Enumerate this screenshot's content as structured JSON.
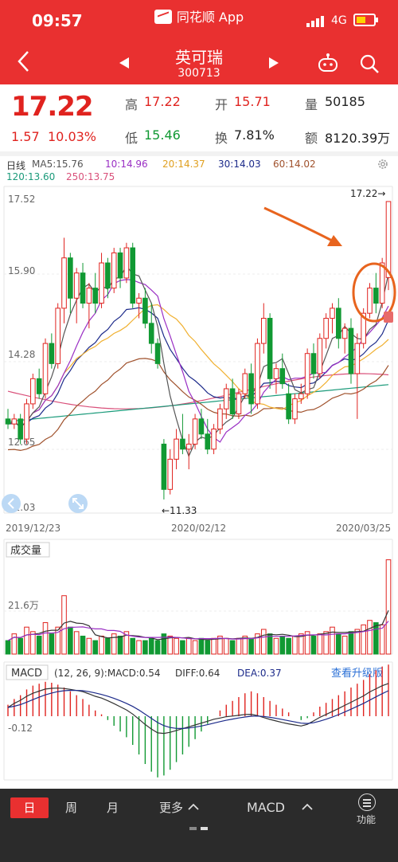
{
  "status_bar": {
    "time": "09:57",
    "app_name": "同花顺 App",
    "network": "4G"
  },
  "nav": {
    "stock_name": "英可瑞",
    "stock_code": "300713"
  },
  "quote": {
    "price": "17.22",
    "change": "1.57",
    "change_pct": "10.03%",
    "high_label": "高",
    "high": "17.22",
    "open_label": "开",
    "open": "15.71",
    "volume_label": "量",
    "volume": "50185",
    "low_label": "低",
    "low": "15.46",
    "turnover_label": "换",
    "turnover": "7.81%",
    "amount_label": "额",
    "amount": "8120.39万"
  },
  "indicators": {
    "period": "日线",
    "ma5": "MA5:15.76",
    "ma10": "10:14.96",
    "ma20": "20:14.37",
    "ma30": "30:14.03",
    "ma60": "60:14.02",
    "ma120": "120:13.60",
    "ma250": "250:13.75"
  },
  "colors": {
    "up": "#e0231f",
    "down": "#119933",
    "ma5": "#555555",
    "ma10": "#9a2fc4",
    "ma20": "#f0b030",
    "ma30": "#1c2a8a",
    "ma60": "#a0522d",
    "ma120": "#1a9a7a",
    "ma250": "#d9507a",
    "annotation": "#e8641e",
    "accent_blue": "#2a6fd6"
  },
  "chart_data": [
    {
      "type": "candlestick",
      "ylim": [
        11.03,
        17.52
      ],
      "y_ticks": [
        "17.52",
        "15.90",
        "14.28",
        "12.65",
        "11.03"
      ],
      "x_ticks": [
        "2019/12/23",
        "2020/02/12",
        "2020/03/25"
      ],
      "max_label": "17.22→",
      "min_label": "←11.33",
      "candles": [
        [
          12.9,
          13.1,
          12.7,
          12.8
        ],
        [
          12.8,
          13.0,
          12.7,
          12.9
        ],
        [
          12.9,
          13.0,
          12.4,
          12.5
        ],
        [
          12.5,
          13.3,
          12.4,
          13.2
        ],
        [
          13.2,
          13.8,
          13.1,
          13.7
        ],
        [
          13.7,
          13.9,
          13.3,
          13.4
        ],
        [
          13.4,
          14.5,
          13.3,
          14.4
        ],
        [
          14.4,
          14.6,
          13.9,
          14.0
        ],
        [
          14.0,
          15.2,
          13.9,
          15.1
        ],
        [
          15.1,
          16.5,
          14.8,
          16.1
        ],
        [
          16.1,
          16.2,
          15.0,
          15.3
        ],
        [
          15.3,
          15.9,
          14.8,
          15.8
        ],
        [
          15.8,
          16.0,
          15.1,
          15.2
        ],
        [
          15.2,
          15.6,
          14.7,
          15.5
        ],
        [
          15.5,
          15.8,
          15.0,
          15.2
        ],
        [
          15.2,
          16.2,
          15.1,
          16.0
        ],
        [
          16.0,
          16.1,
          15.3,
          15.5
        ],
        [
          15.5,
          16.3,
          15.4,
          16.2
        ],
        [
          16.2,
          16.3,
          15.5,
          15.7
        ],
        [
          15.7,
          16.4,
          15.6,
          16.3
        ],
        [
          16.3,
          16.4,
          15.1,
          15.2
        ],
        [
          15.2,
          15.4,
          14.9,
          15.3
        ],
        [
          15.3,
          15.5,
          14.7,
          14.8
        ],
        [
          14.8,
          15.2,
          14.2,
          14.4
        ],
        [
          14.4,
          14.5,
          13.9,
          14.0
        ],
        [
          12.4,
          12.5,
          11.3,
          11.5
        ],
        [
          11.5,
          12.3,
          11.4,
          12.1
        ],
        [
          12.1,
          12.7,
          11.9,
          12.5
        ],
        [
          12.5,
          13.0,
          12.2,
          12.3
        ],
        [
          12.3,
          12.6,
          11.9,
          12.4
        ],
        [
          12.4,
          13.0,
          12.3,
          12.9
        ],
        [
          12.9,
          13.1,
          12.5,
          12.6
        ],
        [
          12.6,
          12.9,
          12.2,
          12.3
        ],
        [
          12.3,
          12.8,
          12.2,
          12.7
        ],
        [
          12.7,
          13.2,
          12.6,
          13.1
        ],
        [
          13.1,
          13.6,
          12.9,
          13.5
        ],
        [
          13.5,
          13.7,
          12.9,
          13.0
        ],
        [
          13.0,
          13.5,
          12.9,
          13.4
        ],
        [
          13.4,
          13.9,
          13.3,
          13.8
        ],
        [
          13.8,
          14.0,
          13.0,
          13.2
        ],
        [
          13.2,
          14.5,
          13.1,
          14.4
        ],
        [
          14.4,
          15.2,
          14.2,
          14.9
        ],
        [
          14.9,
          15.0,
          13.5,
          13.7
        ],
        [
          13.7,
          14.0,
          13.4,
          13.9
        ],
        [
          13.9,
          14.2,
          13.5,
          13.6
        ],
        [
          13.4,
          13.6,
          12.8,
          12.9
        ],
        [
          12.9,
          13.4,
          12.8,
          13.3
        ],
        [
          13.3,
          13.6,
          13.2,
          13.4
        ],
        [
          13.4,
          14.3,
          13.3,
          14.2
        ],
        [
          14.2,
          14.4,
          13.7,
          13.8
        ],
        [
          13.8,
          14.6,
          13.7,
          14.5
        ],
        [
          14.5,
          15.0,
          14.3,
          14.9
        ],
        [
          14.9,
          15.2,
          14.6,
          15.1
        ],
        [
          15.1,
          15.3,
          14.3,
          14.5
        ],
        [
          14.5,
          14.8,
          14.2,
          14.7
        ],
        [
          14.7,
          14.9,
          13.6,
          13.8
        ],
        [
          13.8,
          14.6,
          12.9,
          14.4
        ],
        [
          14.4,
          15.1,
          14.3,
          15.0
        ],
        [
          15.0,
          15.6,
          14.9,
          15.5
        ],
        [
          15.5,
          15.8,
          15.0,
          15.2
        ],
        [
          15.2,
          16.1,
          15.1,
          16.0
        ],
        [
          15.71,
          17.22,
          15.46,
          17.22
        ]
      ]
    },
    {
      "type": "bar",
      "title": "成交量",
      "y_tick": "21.6万",
      "values": [
        6,
        9,
        7,
        12,
        10,
        8,
        14,
        9,
        12,
        26,
        12,
        10,
        8,
        7,
        6,
        8,
        7,
        9,
        8,
        10,
        7,
        6,
        6,
        7,
        6,
        9,
        8,
        7,
        6,
        7,
        6,
        7,
        6,
        7,
        8,
        7,
        6,
        7,
        8,
        7,
        9,
        11,
        9,
        7,
        8,
        7,
        8,
        9,
        10,
        8,
        9,
        10,
        12,
        9,
        8,
        10,
        11,
        13,
        15,
        14,
        13,
        42
      ]
    },
    {
      "type": "bar",
      "title": "MACD",
      "params": "(12, 26, 9):MACD:0.54",
      "diff": "DIFF:0.64",
      "dea": "DEA:0.37",
      "upgrade": "查看升级版",
      "y_tick": "-0.12",
      "values": [
        0.12,
        0.18,
        0.22,
        0.28,
        0.32,
        0.34,
        0.36,
        0.35,
        0.33,
        0.3,
        0.26,
        0.22,
        0.18,
        0.12,
        0.06,
        0.02,
        -0.04,
        -0.1,
        -0.16,
        -0.22,
        -0.3,
        -0.4,
        -0.5,
        -0.58,
        -0.64,
        -0.62,
        -0.56,
        -0.48,
        -0.4,
        -0.32,
        -0.24,
        -0.16,
        -0.08,
        0.0,
        0.06,
        0.12,
        0.16,
        0.2,
        0.24,
        0.26,
        0.24,
        0.2,
        0.16,
        0.12,
        0.08,
        0.04,
        0.0,
        -0.04,
        -0.02,
        0.04,
        0.1,
        0.14,
        0.18,
        0.22,
        0.26,
        0.3,
        0.34,
        0.38,
        0.44,
        0.48,
        0.52,
        0.54
      ]
    }
  ],
  "bottom_bar": {
    "tab_day": "日",
    "tab_week": "周",
    "tab_month": "月",
    "more": "更多",
    "indicator": "MACD",
    "function": "功能"
  }
}
